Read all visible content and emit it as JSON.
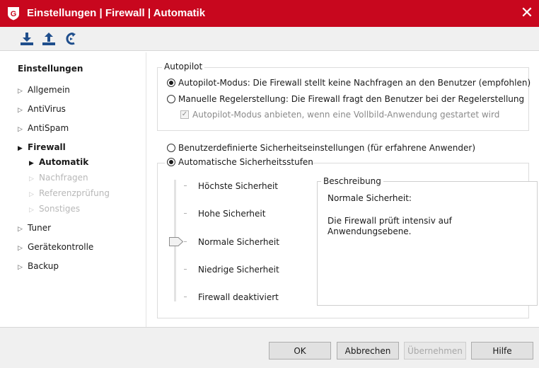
{
  "window": {
    "title": "Einstellungen | Firewall | Automatik",
    "close_glyph": "✕",
    "brand_color": "#c8071e"
  },
  "toolbar": {
    "import_icon": "download-tray-icon",
    "export_icon": "upload-tray-icon",
    "reset_icon": "reset-arrow-icon",
    "icon_color": "#1f4e8c"
  },
  "sidebar": {
    "heading": "Einstellungen",
    "items": [
      {
        "label": "Allgemein"
      },
      {
        "label": "AntiVirus"
      },
      {
        "label": "AntiSpam"
      },
      {
        "label": "Firewall",
        "expanded": true
      },
      {
        "label": "Tuner"
      },
      {
        "label": "Gerätekontrolle"
      },
      {
        "label": "Backup"
      }
    ],
    "firewall_children": [
      {
        "label": "Automatik",
        "selected": true
      },
      {
        "label": "Nachfragen",
        "disabled": true
      },
      {
        "label": "Referenzprüfung",
        "disabled": true
      },
      {
        "label": "Sonstiges",
        "disabled": true
      }
    ]
  },
  "autopilot": {
    "legend": "Autopilot",
    "option_auto": "Autopilot-Modus: Die Firewall stellt keine Nachfragen an den Benutzer (empfohlen)",
    "option_manual": "Manuelle Regelerstellung: Die Firewall fragt den Benutzer bei der Regelerstellung",
    "fullscreen_check": "Autopilot-Modus anbieten, wenn eine Vollbild-Anwendung gestartet wird",
    "selected": "auto",
    "fullscreen_checked": true,
    "fullscreen_enabled": false
  },
  "security": {
    "option_custom": "Benutzerdefinierte Sicherheitseinstellungen (für erfahrene Anwender)",
    "option_auto": "Automatische Sicherheitsstufen",
    "selected": "auto",
    "levels": [
      "Höchste Sicherheit",
      "Hohe Sicherheit",
      "Normale Sicherheit",
      "Niedrige Sicherheit",
      "Firewall deaktiviert"
    ],
    "current_level": "Normale Sicherheit",
    "description": {
      "legend": "Beschreibung",
      "title": "Normale Sicherheit:",
      "text": "Die Firewall prüft intensiv auf Anwendungsebene."
    }
  },
  "footer": {
    "ok": "OK",
    "cancel": "Abbrechen",
    "apply": "Übernehmen",
    "help": "Hilfe"
  }
}
